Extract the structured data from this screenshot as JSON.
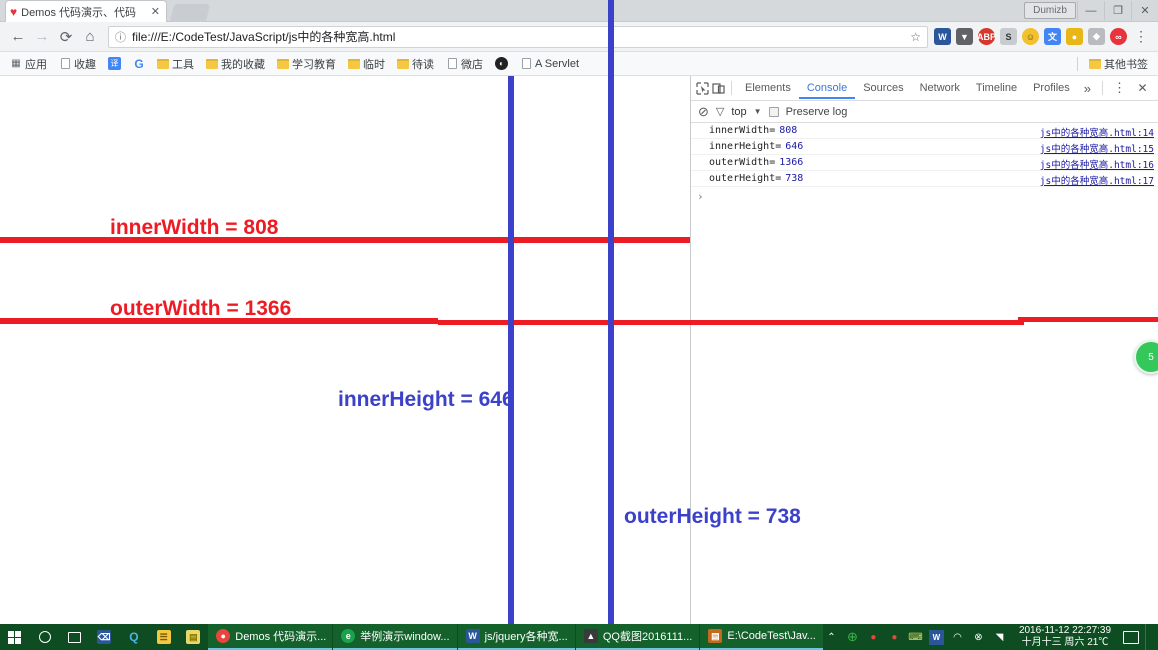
{
  "window": {
    "user_button": "Dumizb",
    "controls": [
      {
        "name": "minimize",
        "glyph": "—"
      },
      {
        "name": "maximize",
        "glyph": "❐"
      },
      {
        "name": "close",
        "glyph": "✕"
      }
    ]
  },
  "tab": {
    "title": "Demos 代码演示、代码",
    "favicon": "♥",
    "close_glyph": "✕"
  },
  "toolbar": {
    "back": "←",
    "forward": "→",
    "reload": "⟳",
    "home": "⌂",
    "url": "file:///E:/CodeTest/JavaScript/js中的各种宽高.html",
    "info_glyph": "ⓘ",
    "star_glyph": "☆",
    "menu_glyph": "⋮",
    "extensions": [
      {
        "name": "word-extension",
        "label": "W",
        "color": "#2b579a"
      },
      {
        "name": "download-extension",
        "label": "▼",
        "color": "#5f6368"
      },
      {
        "name": "adblock-extension",
        "label": "ABP",
        "color": "#d9372b"
      },
      {
        "name": "stylish-extension",
        "label": "S",
        "color": "#8c8c8c"
      },
      {
        "name": "emoji-extension",
        "label": "☺",
        "color": "#f2c12e"
      },
      {
        "name": "google-translate-extension",
        "label": "文",
        "color": "#4285f4"
      },
      {
        "name": "lastpass-extension",
        "label": "●",
        "color": "#e8b617"
      },
      {
        "name": "shield-extension",
        "label": "◆",
        "color": "#b8bcc0"
      },
      {
        "name": "opera-extension",
        "label": "∞",
        "color": "#e8323c"
      }
    ]
  },
  "bookmarks": {
    "items": [
      {
        "label": "应用",
        "icon": "apps-grid"
      },
      {
        "label": "收趣",
        "icon": "page"
      },
      {
        "label": "译",
        "icon": "translate-badge"
      },
      {
        "label": "",
        "icon": "google-g"
      },
      {
        "label": "工具",
        "icon": "folder"
      },
      {
        "label": "我的收藏",
        "icon": "folder"
      },
      {
        "label": "学习教育",
        "icon": "folder"
      },
      {
        "label": "临时",
        "icon": "folder"
      },
      {
        "label": "待读",
        "icon": "folder"
      },
      {
        "label": "微店",
        "icon": "page"
      },
      {
        "label": "",
        "icon": "dark-circle"
      },
      {
        "label": "A Servlet",
        "icon": "page"
      }
    ],
    "other": {
      "label": "其他书签",
      "icon": "folder"
    }
  },
  "devtools": {
    "inspect_icon": "inspect-element-icon",
    "device_icon": "device-toolbar-icon",
    "tabs": [
      {
        "label": "Elements",
        "active": false
      },
      {
        "label": "Console",
        "active": true
      },
      {
        "label": "Sources",
        "active": false
      },
      {
        "label": "Network",
        "active": false
      },
      {
        "label": "Timeline",
        "active": false
      },
      {
        "label": "Profiles",
        "active": false
      }
    ],
    "more_glyph": "»",
    "menu_glyph": "⋮",
    "close_glyph": "✕",
    "filterbar": {
      "clear_glyph": "⊘",
      "filter_glyph": "▽",
      "context": "top",
      "caret": "▼",
      "preserve_log": "Preserve log"
    },
    "logs": [
      {
        "message": "innerWidth=",
        "value": "808",
        "source": "js中的各种宽高.html:14"
      },
      {
        "message": "innerHeight=",
        "value": "646",
        "source": "js中的各种宽高.html:15"
      },
      {
        "message": "outerWidth=",
        "value": "1366",
        "source": "js中的各种宽高.html:16"
      },
      {
        "message": "outerHeight=",
        "value": "738",
        "source": "js中的各种宽高.html:17"
      }
    ],
    "prompt": "›"
  },
  "annotations": {
    "colors": {
      "red": "#ed1c24",
      "blue": "#3b41c8"
    },
    "inner_width": "innerWidth  = 808",
    "outer_width": "outerWidth  = 1366",
    "inner_height": "innerHeight = 646",
    "outer_height": "outerHeight = 738"
  },
  "widget": {
    "label": "5"
  },
  "taskbar": {
    "start": "windows-logo",
    "search": "cortana-circle",
    "taskview": "task-view",
    "pinned": [
      {
        "name": "pin-ps",
        "label": "⌫",
        "color": "#2b579a"
      },
      {
        "name": "pin-search",
        "label": "Q",
        "color": "#1f8fd0"
      },
      {
        "name": "pin-explorer",
        "label": "☰",
        "color": "#f5c842"
      },
      {
        "name": "pin-notes",
        "label": "▤",
        "color": "#e8d96a"
      }
    ],
    "items": [
      {
        "label": "Demos 代码演示...",
        "icon": "chrome-icon",
        "color": "#e8463c"
      },
      {
        "label": "举例演示window...",
        "icon": "edge-icon",
        "color": "#1aa34a"
      },
      {
        "label": "js/jquery各种宽...",
        "icon": "word-icon",
        "color": "#2b579a"
      },
      {
        "label": "QQ截图2016111...",
        "icon": "image-icon",
        "color": "#3a3a3a"
      },
      {
        "label": "E:\\CodeTest\\Jav...",
        "icon": "folder-icon",
        "color": "#c46a1a"
      }
    ],
    "tray": [
      {
        "name": "tray-expand",
        "glyph": "⌃"
      },
      {
        "name": "tray-360",
        "glyph": "⊕",
        "color": "#3bb54a"
      },
      {
        "name": "tray-qq-1",
        "glyph": "●",
        "color": "#e8463c"
      },
      {
        "name": "tray-qq-2",
        "glyph": "●",
        "color": "#e8463c"
      },
      {
        "name": "tray-input",
        "glyph": "⌨",
        "color": "#d9d96a"
      },
      {
        "name": "tray-word",
        "glyph": "W",
        "color": "#2b579a"
      },
      {
        "name": "tray-network",
        "glyph": "◠"
      },
      {
        "name": "tray-volume",
        "glyph": "⊗"
      },
      {
        "name": "tray-action",
        "glyph": "◥"
      }
    ],
    "clock": {
      "time": "2016-11-12  22:27:39",
      "date": "十月十三 周六 21℃"
    }
  }
}
